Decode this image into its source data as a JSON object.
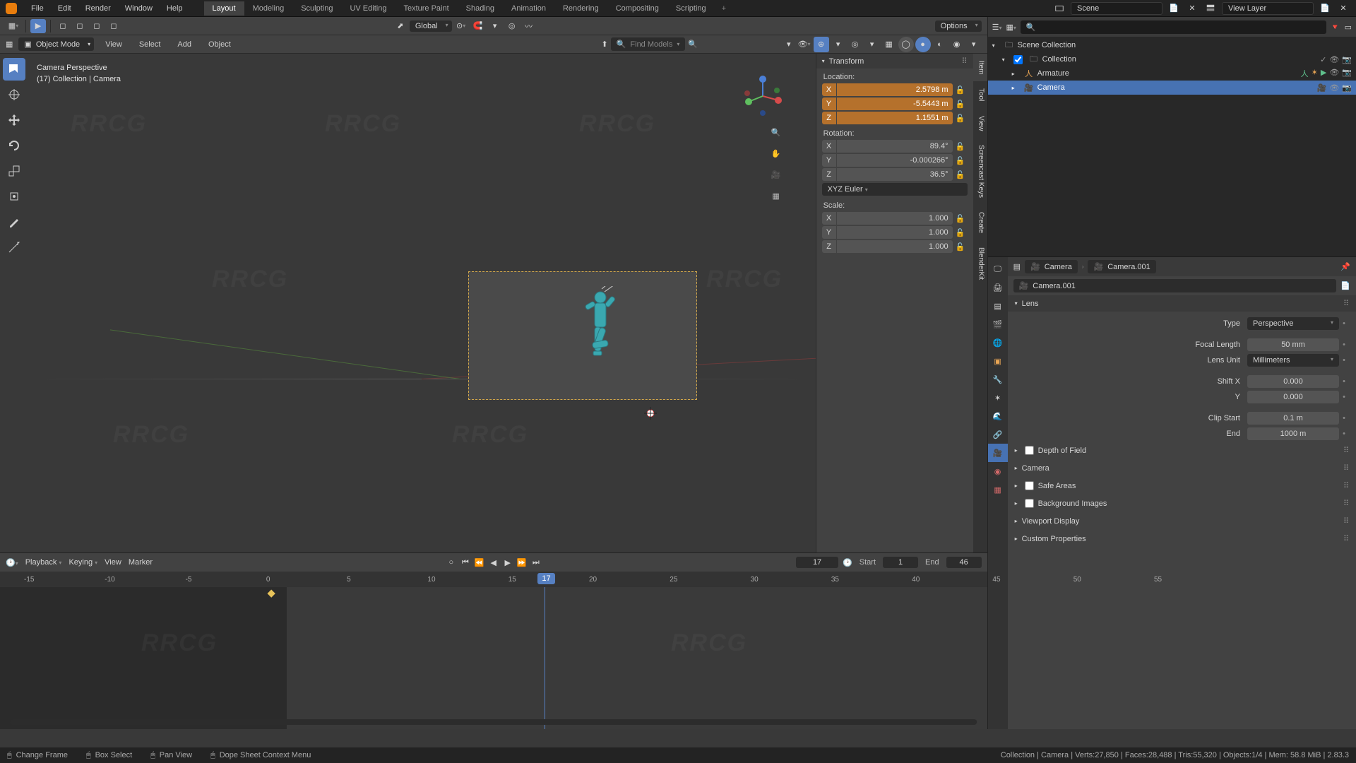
{
  "menubar": {
    "items": [
      "File",
      "Edit",
      "Render",
      "Window",
      "Help"
    ]
  },
  "workspaces": {
    "tabs": [
      "Layout",
      "Modeling",
      "Sculpting",
      "UV Editing",
      "Texture Paint",
      "Shading",
      "Animation",
      "Rendering",
      "Compositing",
      "Scripting"
    ],
    "active": "Layout"
  },
  "topbar": {
    "scene_label": "Scene",
    "viewlayer_label": "View Layer"
  },
  "toolbar2": {
    "orientation": "Global",
    "options_label": "Options"
  },
  "view3d_header": {
    "mode": "Object Mode",
    "menus": [
      "View",
      "Select",
      "Add",
      "Object"
    ],
    "search_placeholder": "Find Models"
  },
  "viewport": {
    "info_line1": "Camera Perspective",
    "info_line2": "(17) Collection | Camera"
  },
  "npanel": {
    "transform_title": "Transform",
    "location_label": "Location:",
    "rotation_label": "Rotation:",
    "scale_label": "Scale:",
    "rotation_mode": "XYZ Euler",
    "location": {
      "x": "2.5798 m",
      "y": "-5.5443 m",
      "z": "1.1551 m"
    },
    "rotation": {
      "x": "89.4°",
      "y": "-0.000266°",
      "z": "36.5°"
    },
    "scale": {
      "x": "1.000",
      "y": "1.000",
      "z": "1.000"
    },
    "tabs": [
      "Item",
      "Tool",
      "View",
      "Screencast Keys",
      "Create",
      "BlenderKit"
    ]
  },
  "timeline": {
    "menus": [
      "Playback",
      "Keying",
      "View",
      "Marker"
    ],
    "current": 17,
    "start_label": "Start",
    "start": 1,
    "end_label": "End",
    "end": 46,
    "ticks": [
      -15,
      -10,
      -5,
      0,
      5,
      10,
      15,
      20,
      25,
      30,
      35,
      40,
      45,
      50,
      55
    ],
    "keyframe_at": 0
  },
  "outliner": {
    "scene_collection": "Scene Collection",
    "items": [
      {
        "name": "Collection",
        "icon": "collection",
        "indent": 1
      },
      {
        "name": "Armature",
        "icon": "armature",
        "indent": 2
      },
      {
        "name": "Camera",
        "icon": "camera",
        "indent": 2,
        "selected": true
      }
    ]
  },
  "properties": {
    "crumb1": "Camera",
    "crumb2": "Camera.001",
    "datablock": "Camera.001",
    "panels": {
      "lens": {
        "title": "Lens",
        "type_label": "Type",
        "type": "Perspective",
        "focal_label": "Focal Length",
        "focal": "50 mm",
        "unit_label": "Lens Unit",
        "unit": "Millimeters",
        "shiftx_label": "Shift X",
        "shiftx": "0.000",
        "shifty_label": "Y",
        "shifty": "0.000",
        "clipstart_label": "Clip Start",
        "clipstart": "0.1 m",
        "clipend_label": "End",
        "clipend": "1000 m"
      },
      "collapsed": [
        "Depth of Field",
        "Camera",
        "Safe Areas",
        "Background Images",
        "Viewport Display",
        "Custom Properties"
      ]
    }
  },
  "statusbar": {
    "items": [
      {
        "icon": "mouse",
        "label": "Change Frame"
      },
      {
        "icon": "mouse",
        "label": "Box Select"
      },
      {
        "icon": "mouse",
        "label": "Pan View"
      },
      {
        "icon": "mouse",
        "label": "Dope Sheet Context Menu"
      }
    ],
    "right": "Collection | Camera | Verts:27,850 | Faces:28,488 | Tris:55,320 | Objects:1/4 | Mem: 58.8 MiB | 2.83.3"
  }
}
